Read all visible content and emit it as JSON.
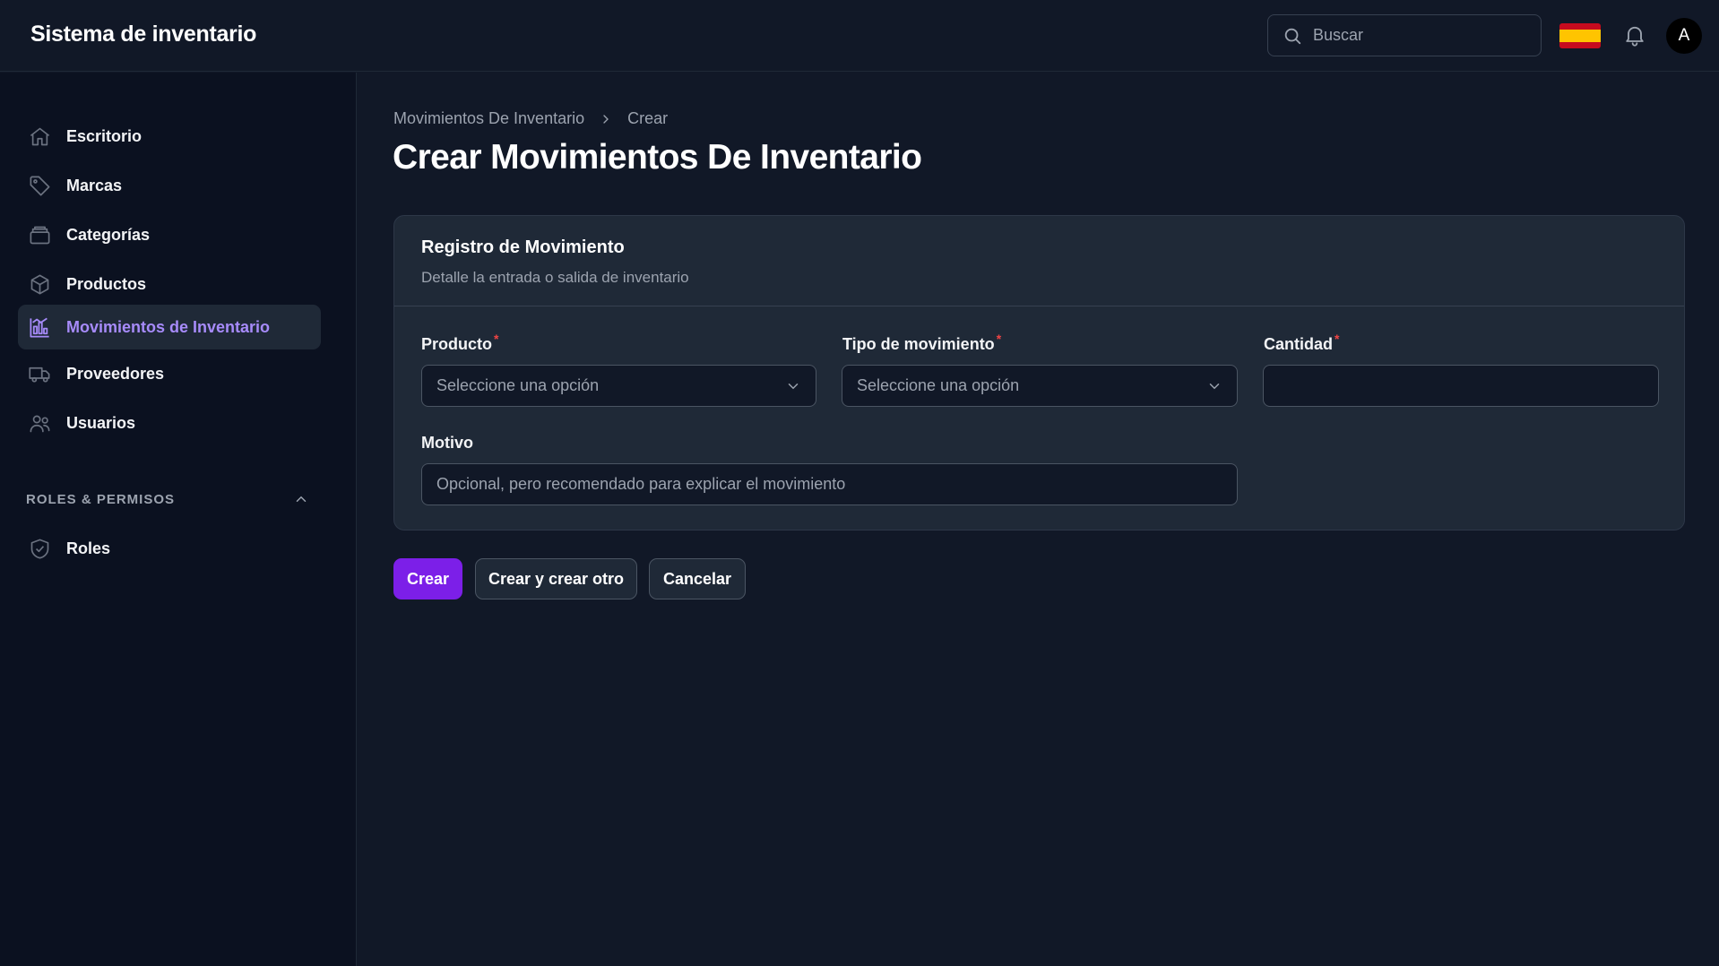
{
  "header": {
    "brand": "Sistema de inventario",
    "search_placeholder": "Buscar",
    "avatar_initial": "A"
  },
  "sidebar": {
    "items": [
      {
        "label": "Escritorio",
        "icon": "home-icon"
      },
      {
        "label": "Marcas",
        "icon": "tag-icon"
      },
      {
        "label": "Categorías",
        "icon": "archive-icon"
      },
      {
        "label": "Productos",
        "icon": "cube-icon"
      },
      {
        "label": "Movimientos de Inventario",
        "icon": "chart-bar-icon",
        "active": true
      },
      {
        "label": "Proveedores",
        "icon": "truck-icon"
      },
      {
        "label": "Usuarios",
        "icon": "users-icon"
      }
    ],
    "section": {
      "title": "ROLES & PERMISOS",
      "items": [
        {
          "label": "Roles",
          "icon": "shield-check-icon"
        }
      ]
    }
  },
  "breadcrumb": {
    "parent": "Movimientos De Inventario",
    "current": "Crear"
  },
  "page": {
    "title": "Crear Movimientos De Inventario"
  },
  "form": {
    "section_title": "Registro de Movimiento",
    "section_description": "Detalle la entrada o salida de inventario",
    "fields": {
      "producto": {
        "label": "Producto",
        "required": "*",
        "placeholder": "Seleccione una opción"
      },
      "tipo": {
        "label": "Tipo de movimiento",
        "required": "*",
        "placeholder": "Seleccione una opción"
      },
      "cantidad": {
        "label": "Cantidad",
        "required": "*",
        "value": ""
      },
      "motivo": {
        "label": "Motivo",
        "placeholder": "Opcional, pero recomendado para explicar el movimiento"
      }
    }
  },
  "actions": {
    "create": "Crear",
    "create_another": "Crear y crear otro",
    "cancel": "Cancelar"
  },
  "colors": {
    "accent": "#7c1fe8",
    "active_text": "#a78bfa",
    "background": "#111827",
    "sidebar": "#0b1120",
    "card": "#1f2937"
  }
}
